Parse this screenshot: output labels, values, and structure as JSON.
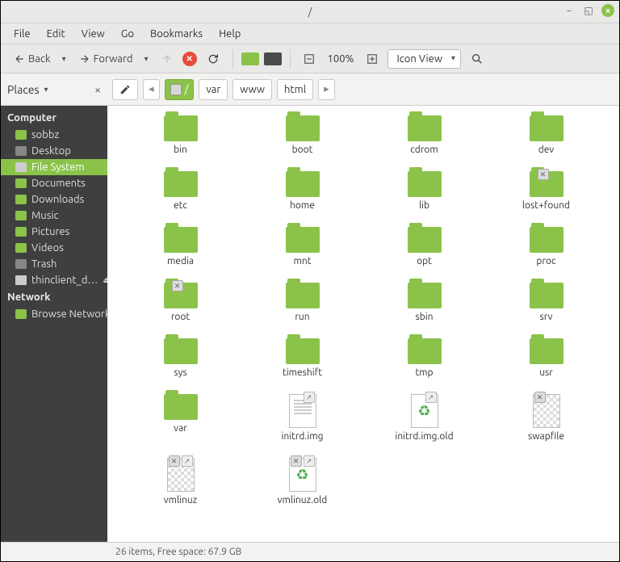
{
  "window": {
    "title": "/"
  },
  "menubar": [
    "File",
    "Edit",
    "View",
    "Go",
    "Bookmarks",
    "Help"
  ],
  "toolbar": {
    "back": "Back",
    "forward": "Forward",
    "zoom": "100%",
    "view_mode": "Icon View"
  },
  "places_header": "Places",
  "path": {
    "segments": [
      "/",
      "var",
      "www",
      "html"
    ]
  },
  "sidebar": {
    "computer": {
      "label": "Computer",
      "items": [
        {
          "label": "sobbz",
          "icon": "folder"
        },
        {
          "label": "Desktop",
          "icon": "gray"
        },
        {
          "label": "File System",
          "icon": "disk",
          "selected": true
        },
        {
          "label": "Documents",
          "icon": "folder"
        },
        {
          "label": "Downloads",
          "icon": "folder"
        },
        {
          "label": "Music",
          "icon": "folder"
        },
        {
          "label": "Pictures",
          "icon": "folder"
        },
        {
          "label": "Videos",
          "icon": "folder"
        },
        {
          "label": "Trash",
          "icon": "gray"
        },
        {
          "label": "thinclient_d…",
          "icon": "disk",
          "eject": true
        }
      ]
    },
    "network": {
      "label": "Network",
      "items": [
        {
          "label": "Browse Network",
          "icon": "folder"
        }
      ]
    }
  },
  "files": [
    {
      "name": "bin",
      "type": "folder"
    },
    {
      "name": "boot",
      "type": "folder"
    },
    {
      "name": "cdrom",
      "type": "folder"
    },
    {
      "name": "dev",
      "type": "folder"
    },
    {
      "name": "etc",
      "type": "folder"
    },
    {
      "name": "home",
      "type": "folder"
    },
    {
      "name": "lib",
      "type": "folder"
    },
    {
      "name": "lost+found",
      "type": "folder",
      "restricted": true
    },
    {
      "name": "media",
      "type": "folder"
    },
    {
      "name": "mnt",
      "type": "folder"
    },
    {
      "name": "opt",
      "type": "folder"
    },
    {
      "name": "proc",
      "type": "folder"
    },
    {
      "name": "root",
      "type": "folder",
      "restricted": true
    },
    {
      "name": "run",
      "type": "folder"
    },
    {
      "name": "sbin",
      "type": "folder"
    },
    {
      "name": "srv",
      "type": "folder"
    },
    {
      "name": "sys",
      "type": "folder"
    },
    {
      "name": "timeshift",
      "type": "folder"
    },
    {
      "name": "tmp",
      "type": "folder"
    },
    {
      "name": "usr",
      "type": "folder"
    },
    {
      "name": "var",
      "type": "folder"
    },
    {
      "name": "initrd.img",
      "type": "text-file",
      "link": true
    },
    {
      "name": "initrd.img.old",
      "type": "recycle-file",
      "link": true
    },
    {
      "name": "swapfile",
      "type": "swap-file",
      "restricted": true
    },
    {
      "name": "vmlinuz",
      "type": "swap-file",
      "restricted": true,
      "link": true
    },
    {
      "name": "vmlinuz.old",
      "type": "recycle-file",
      "restricted": true,
      "link": true
    }
  ],
  "statusbar": "26 items, Free space: 67.9 GB"
}
